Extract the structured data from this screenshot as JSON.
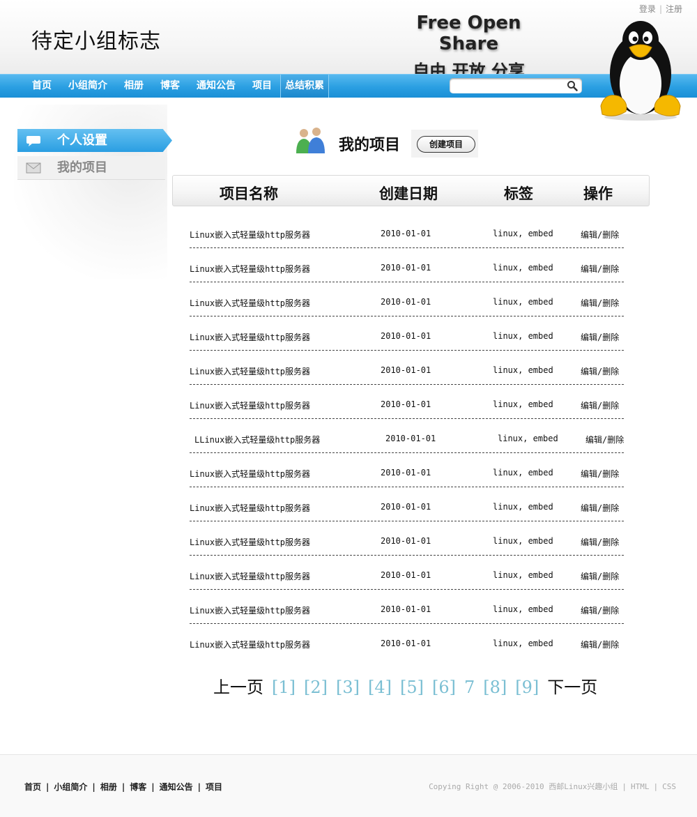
{
  "header": {
    "logo_text": "待定小组标志",
    "login": "登录",
    "register": "注册",
    "slogan_en": "Free Open Share",
    "slogan_cn": "自由 开放 分享"
  },
  "nav": {
    "items": [
      "首页",
      "小组简介",
      "相册",
      "博客",
      "通知公告",
      "项目",
      "总结积累"
    ],
    "active_index": 6,
    "search_value": ""
  },
  "sidebar": {
    "items": [
      {
        "label": "个人设置",
        "icon": "speech-bubble-icon"
      },
      {
        "label": "我的项目",
        "icon": "envelope-icon"
      }
    ]
  },
  "main": {
    "title": "我的项目",
    "create_button": "创建项目",
    "columns": [
      "项目名称",
      "创建日期",
      "标签",
      "操作"
    ],
    "rows": [
      {
        "name": "Linux嵌入式轻量级http服务器",
        "date": "2010-01-01",
        "tags": "linux, embed",
        "action": "编辑/删除"
      },
      {
        "name": "Linux嵌入式轻量级http服务器",
        "date": "2010-01-01",
        "tags": "linux, embed",
        "action": "编辑/删除"
      },
      {
        "name": "Linux嵌入式轻量级http服务器",
        "date": "2010-01-01",
        "tags": "linux, embed",
        "action": "编辑/删除"
      },
      {
        "name": "Linux嵌入式轻量级http服务器",
        "date": "2010-01-01",
        "tags": "linux, embed",
        "action": "编辑/删除"
      },
      {
        "name": "Linux嵌入式轻量级http服务器",
        "date": "2010-01-01",
        "tags": "linux, embed",
        "action": "编辑/删除"
      },
      {
        "name": "Linux嵌入式轻量级http服务器",
        "date": "2010-01-01",
        "tags": "linux, embed",
        "action": "编辑/删除"
      },
      {
        "name": "LLinux嵌入式轻量级http服务器",
        "date": "2010-01-01",
        "tags": "linux, embed",
        "action": "编辑/删除"
      },
      {
        "name": "Linux嵌入式轻量级http服务器",
        "date": "2010-01-01",
        "tags": "linux, embed",
        "action": "编辑/删除"
      },
      {
        "name": "Linux嵌入式轻量级http服务器",
        "date": "2010-01-01",
        "tags": "linux, embed",
        "action": "编辑/删除"
      },
      {
        "name": "Linux嵌入式轻量级http服务器",
        "date": "2010-01-01",
        "tags": "linux, embed",
        "action": "编辑/删除"
      },
      {
        "name": "Linux嵌入式轻量级http服务器",
        "date": "2010-01-01",
        "tags": "linux, embed",
        "action": "编辑/删除"
      },
      {
        "name": "Linux嵌入式轻量级http服务器",
        "date": "2010-01-01",
        "tags": "linux, embed",
        "action": "编辑/删除"
      },
      {
        "name": "Linux嵌入式轻量级http服务器",
        "date": "2010-01-01",
        "tags": "linux, embed",
        "action": "编辑/删除"
      }
    ]
  },
  "pager": {
    "prev": "上一页",
    "pages": [
      "[1]",
      "[2]",
      "[3]",
      "[4]",
      "[5]",
      "[6]",
      "7",
      "[8]",
      "[9]"
    ],
    "next": "下一页"
  },
  "footer": {
    "links": [
      "首页",
      "小组简介",
      "相册",
      "博客",
      "通知公告",
      "项目"
    ],
    "copyright": "Copying Right @ 2006-2010 西邮Linux兴趣小组",
    "html": "HTML",
    "css": "CSS"
  },
  "colors": {
    "nav_blue": "#2a9fe2",
    "pager_link": "#7bbfd3"
  }
}
